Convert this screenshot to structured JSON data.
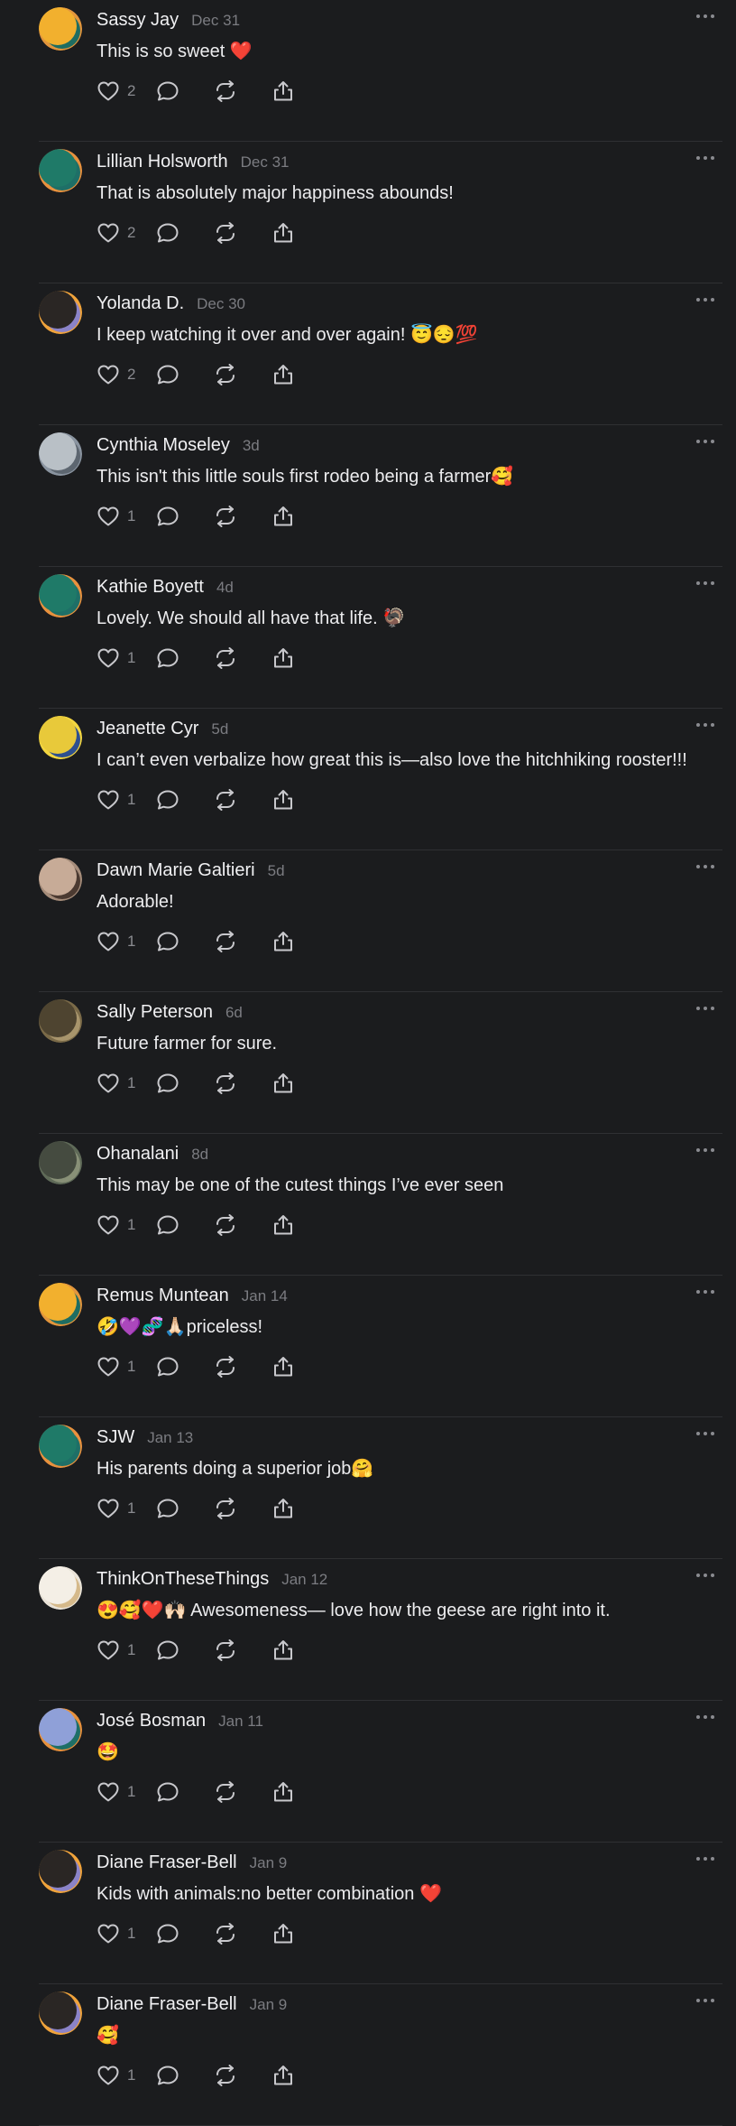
{
  "colors": {
    "background": "#1b1c1e",
    "divider": "#2f3033",
    "text_primary": "#f1f1f3",
    "text_secondary": "#7b7c81",
    "icon": "#c8c8cc"
  },
  "comments": [
    {
      "author": "Sassy Jay",
      "time": "Dec 31",
      "text": "This is so sweet ❤️",
      "likes": "2",
      "avatar_colors": [
        "#e2953c",
        "#1e6d62",
        "#f2b02e"
      ]
    },
    {
      "author": "Lillian Holsworth",
      "time": "Dec 31",
      "text": "That is absolutely major happiness abounds!",
      "likes": "2",
      "avatar_colors": [
        "#e8913e",
        "#1e6f67",
        "#1f7a68"
      ]
    },
    {
      "author": "Yolanda D.",
      "time": "Dec 30",
      "text": "I keep watching it over and over again! 😇😔💯",
      "likes": "2",
      "avatar_colors": [
        "#f0a33b",
        "#8b83c8",
        "#2a2624"
      ]
    },
    {
      "author": "Cynthia Moseley",
      "time": "3d",
      "text": "This isn't this little souls first rodeo being a farmer🥰",
      "likes": "1",
      "avatar_colors": [
        "#8a94a0",
        "#5d6670",
        "#b9c0c6"
      ]
    },
    {
      "author": "Kathie Boyett",
      "time": "4d",
      "text": "Lovely. We should all have that life. 🦃",
      "likes": "1",
      "avatar_colors": [
        "#e8913e",
        "#1e6f67",
        "#1f7a68"
      ]
    },
    {
      "author": "Jeanette Cyr",
      "time": "5d",
      "text": "I can’t even verbalize how great this is—also love the hitchhiking rooster!!!",
      "likes": "1",
      "avatar_colors": [
        "#f3d640",
        "#2d4f8f",
        "#e8c93a"
      ]
    },
    {
      "author": "Dawn Marie Galtieri",
      "time": "5d",
      "text": "Adorable!",
      "likes": "1",
      "avatar_colors": [
        "#a58c7a",
        "#4b3a31",
        "#c7ab97"
      ]
    },
    {
      "author": "Sally Peterson",
      "time": "6d",
      "text": "Future farmer for sure.",
      "likes": "1",
      "avatar_colors": [
        "#7a6a48",
        "#a8956c",
        "#4e4430"
      ]
    },
    {
      "author": "Ohanalani",
      "time": "8d",
      "text": "This may be one of the cutest things I’ve ever seen",
      "likes": "1",
      "avatar_colors": [
        "#5f6a58",
        "#889077",
        "#454b40"
      ]
    },
    {
      "author": "Remus Muntean",
      "time": "Jan 14",
      "text": "🤣💜🧬🙏🏻priceless!",
      "likes": "1",
      "avatar_colors": [
        "#e2953c",
        "#1e6d62",
        "#f2b02e"
      ]
    },
    {
      "author": "SJW",
      "time": "Jan 13",
      "text": "His parents doing a superior job🤗",
      "likes": "1",
      "avatar_colors": [
        "#e8913e",
        "#1e6f67",
        "#1f7a68"
      ]
    },
    {
      "author": "ThinkOnTheseThings",
      "time": "Jan 12",
      "text": "😍🥰❤️🙌🏻 Awesomeness— love how the geese are right into it.",
      "likes": "1",
      "avatar_colors": [
        "#e9e3d8",
        "#d5b98a",
        "#f4efe6"
      ]
    },
    {
      "author": "José Bosman",
      "time": "Jan 11",
      "text": "🤩",
      "likes": "1",
      "avatar_colors": [
        "#e7903c",
        "#1e6f67",
        "#8fa0d8"
      ]
    },
    {
      "author": "Diane Fraser-Bell",
      "time": "Jan 9",
      "text": "Kids with animals:no better combination ❤️",
      "likes": "1",
      "avatar_colors": [
        "#f0a33b",
        "#8b83c8",
        "#2a2624"
      ]
    },
    {
      "author": "Diane Fraser-Bell",
      "time": "Jan 9",
      "text": "🥰",
      "likes": "1",
      "avatar_colors": [
        "#f0a33b",
        "#8b83c8",
        "#2a2624"
      ]
    }
  ],
  "icons": {
    "like": "heart-icon",
    "reply": "reply-bubble-icon",
    "repost": "repost-icon",
    "share": "share-icon",
    "more": "more-horizontal-icon"
  }
}
